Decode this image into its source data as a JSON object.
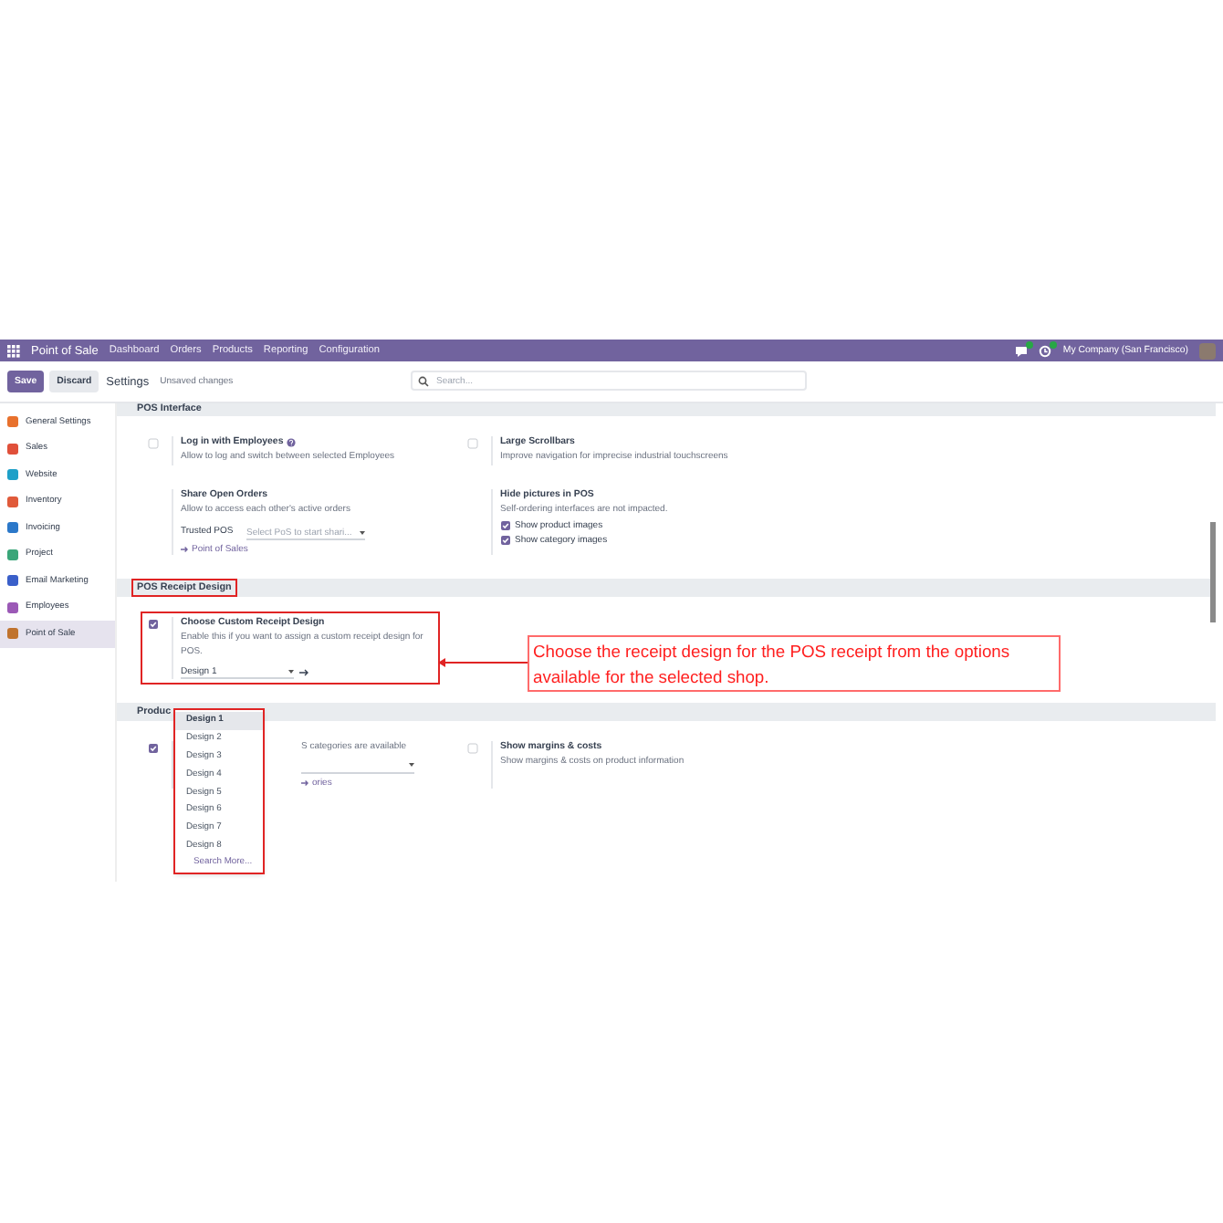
{
  "navbar": {
    "app": "Point of Sale",
    "menu": [
      "Dashboard",
      "Orders",
      "Products",
      "Reporting",
      "Configuration"
    ],
    "company": "My Company (San Francisco)"
  },
  "control_bar": {
    "buttons": [
      {
        "label": "Save",
        "kind": "primary"
      },
      {
        "label": "Discard",
        "kind": "secondary"
      }
    ],
    "title": "Settings",
    "status": "Unsaved changes",
    "search": {
      "placeholder": "Search..."
    }
  },
  "sidebar": {
    "items": [
      {
        "label": "General Settings",
        "color": "#e8712d",
        "selected": false
      },
      {
        "label": "Sales",
        "color": "#e0503a",
        "selected": false
      },
      {
        "label": "Website",
        "color": "#1ea0c8",
        "selected": false
      },
      {
        "label": "Inventory",
        "color": "#e05a3a",
        "selected": false
      },
      {
        "label": "Invoicing",
        "color": "#2b78c9",
        "selected": false
      },
      {
        "label": "Project",
        "color": "#3aa679",
        "selected": false
      },
      {
        "label": "Email Marketing",
        "color": "#3a5fc9",
        "selected": false
      },
      {
        "label": "Employees",
        "color": "#9b59b6",
        "selected": false
      },
      {
        "label": "Point of Sale",
        "color": "#c0732e",
        "selected": true
      }
    ]
  },
  "sections": [
    {
      "title": "POS Interface",
      "annotated": false,
      "settings": [
        {
          "kind": "check",
          "checked": false,
          "annotated": false,
          "title": "Log in with Employees",
          "help": true,
          "description": "Allow to log and switch between selected Employees"
        },
        {
          "kind": "check",
          "checked": false,
          "annotated": false,
          "title": "Large Scrollbars",
          "description": "Improve navigation for imprecise industrial touchscreens"
        },
        {
          "kind": "plain",
          "annotated": false,
          "title": "Share Open Orders",
          "description": "Allow to access each other's active orders",
          "field": {
            "label": "Trusted POS",
            "placeholder": "Select PoS to start shari..."
          },
          "link": "Point of Sales"
        },
        {
          "kind": "plain",
          "annotated": false,
          "title": "Hide pictures in POS",
          "description": "Self-ordering interfaces are not impacted.",
          "options": [
            {
              "label": "Show product images",
              "checked": true
            },
            {
              "label": "Show category images",
              "checked": true
            }
          ]
        }
      ]
    },
    {
      "title": "POS Receipt Design",
      "annotated": true,
      "settings": [
        {
          "kind": "check",
          "checked": true,
          "annotated": true,
          "title": "Choose Custom Receipt Design",
          "description": "Enable this if you want to assign a custom receipt design for POS.",
          "select": {
            "value": "Design 1"
          }
        }
      ]
    },
    {
      "title": "Produc",
      "annotated": false,
      "settings": [
        {
          "kind": "check",
          "checked": true,
          "annotated": false,
          "description": "S categories are available",
          "empty_select": true,
          "link": "ories"
        },
        {
          "kind": "check",
          "checked": false,
          "annotated": false,
          "title": "Show margins & costs",
          "description": "Show margins & costs on product information"
        }
      ]
    }
  ],
  "dropdown": {
    "options": [
      {
        "label": "Design 1",
        "selected": true
      },
      {
        "label": "Design 2",
        "selected": false
      },
      {
        "label": "Design 3",
        "selected": false
      },
      {
        "label": "Design 4",
        "selected": false
      },
      {
        "label": "Design 5",
        "selected": false
      },
      {
        "label": "Design 6",
        "selected": false
      },
      {
        "label": "Design 7",
        "selected": false
      },
      {
        "label": "Design 8",
        "selected": false
      }
    ],
    "search_more": "Search More..."
  },
  "callout": {
    "text": "Choose the receipt design for the POS receipt from the options available for the selected shop."
  }
}
